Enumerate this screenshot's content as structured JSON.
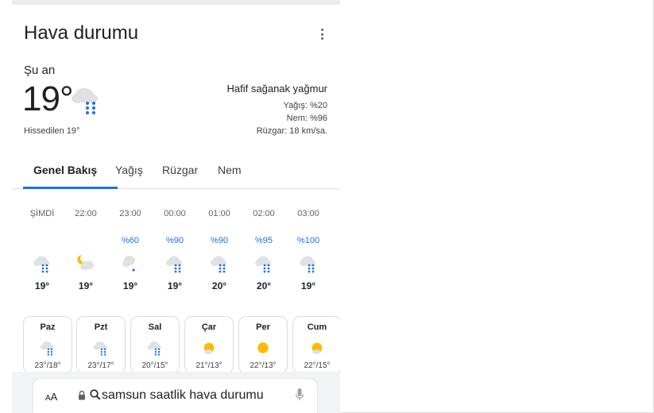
{
  "widget": {
    "title": "Hava durumu",
    "current": {
      "label": "Şu an",
      "temperature": "19°",
      "feels_like": "Hissedilen 19°",
      "condition": "Hafif sağanak yağmur",
      "precip": "Yağış: %20",
      "humidity": "Nem: %96",
      "wind": "Rüzgar: 18 km/sa.",
      "icon": "cloud-rain-icon"
    },
    "tabs": [
      {
        "label": "Genel Bakış",
        "active": true
      },
      {
        "label": "Yağış",
        "active": false
      },
      {
        "label": "Rüzgar",
        "active": false
      },
      {
        "label": "Nem",
        "active": false
      }
    ],
    "hourly": [
      {
        "time": "ŞİMDİ",
        "precip": "",
        "temp": "19°",
        "icon": "cloud-rain-icon"
      },
      {
        "time": "22:00",
        "precip": "",
        "temp": "19°",
        "icon": "moon-cloud-icon"
      },
      {
        "time": "23:00",
        "precip": "%60",
        "temp": "19°",
        "icon": "cloud-drizzle-icon"
      },
      {
        "time": "00:00",
        "precip": "%90",
        "temp": "19°",
        "icon": "cloud-rain-icon"
      },
      {
        "time": "01:00",
        "precip": "%90",
        "temp": "20°",
        "icon": "cloud-rain-icon"
      },
      {
        "time": "02:00",
        "precip": "%95",
        "temp": "20°",
        "icon": "cloud-rain-icon"
      },
      {
        "time": "03:00",
        "precip": "%100",
        "temp": "19°",
        "icon": "cloud-rain-icon"
      }
    ],
    "daily": [
      {
        "day": "Paz",
        "temps": "23°/18°",
        "icon": "cloud-rain-icon"
      },
      {
        "day": "Pzt",
        "temps": "23°/17°",
        "icon": "cloud-rain-icon"
      },
      {
        "day": "Sal",
        "temps": "20°/15°",
        "icon": "cloud-rain-icon"
      },
      {
        "day": "Çar",
        "temps": "21°/13°",
        "icon": "sun-cloud-icon"
      },
      {
        "day": "Per",
        "temps": "22°/13°",
        "icon": "sun-icon"
      },
      {
        "day": "Cum",
        "temps": "22°/15°",
        "icon": "sun-cloud-icon"
      }
    ]
  },
  "browser": {
    "text_size_label": "AA",
    "url": "samsun saatlik hava durumu"
  },
  "colors": {
    "accent": "#1a73e8",
    "rain_drop": "#1a73e8",
    "cloud": "#dfe1e5",
    "sun": "#fbbc04"
  }
}
